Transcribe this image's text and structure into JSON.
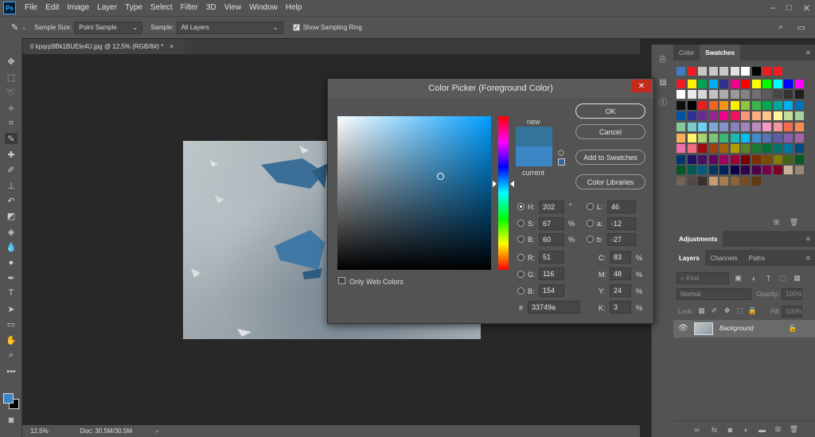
{
  "app": {
    "logo": "Ps"
  },
  "menu": [
    "File",
    "Edit",
    "Image",
    "Layer",
    "Type",
    "Select",
    "Filter",
    "3D",
    "View",
    "Window",
    "Help"
  ],
  "window_controls": {
    "minimize": "–",
    "restore": "□",
    "close": "✕"
  },
  "options": {
    "sample_size_label": "Sample Size:",
    "sample_size_value": "Point Sample",
    "sample_label": "Sample:",
    "sample_value": "All Layers",
    "show_ring_label": "Show Sampling Ring",
    "show_ring_checked": true
  },
  "document": {
    "tab_title": "0 kpqrp9Bk1BUEle4U.jpg @ 12.5% (RGB/8#) *",
    "close": "×"
  },
  "status": {
    "zoom": "12.5%",
    "doc_info": "Doc: 30.5M/30.5M",
    "arrow": "›"
  },
  "swatches_panel": {
    "tabs": [
      "Color",
      "Swatches"
    ],
    "active": "Swatches",
    "colors": [
      [
        "#3d7cc2",
        "#ee1d24",
        "#c8c8c8",
        "#c8c8c8",
        "#c8c8c8",
        "#e0e0e0",
        "#ffffff",
        "#000000",
        "#ee1d24",
        "#ee1d24"
      ],
      [
        "#ee1d24",
        "#fff200",
        "#00a651",
        "#00aeef",
        "#2e3192",
        "#ec008c",
        "#ff0000",
        "#ffff00",
        "#00ff00",
        "#00ffff",
        "#0000ff",
        "#ff00ff"
      ],
      [
        "#ffffff",
        "#ebebeb",
        "#d7d7d7",
        "#c2c2c2",
        "#adadad",
        "#999999",
        "#858585",
        "#707070",
        "#5c5c5c",
        "#474747",
        "#333333",
        "#1f1f1f"
      ],
      [
        "#0f0f0f",
        "#000000",
        "#ed1c24",
        "#f26522",
        "#f7941d",
        "#fff200",
        "#8dc63f",
        "#39b54a",
        "#00a651",
        "#00a99d",
        "#00aeef",
        "#0072bc"
      ],
      [
        "#0054a6",
        "#2e3192",
        "#662d91",
        "#92278f",
        "#ec008c",
        "#ed145b",
        "#f7977a",
        "#f9ad81",
        "#fdc68a",
        "#fff79a",
        "#c4df9b",
        "#a3d39c"
      ],
      [
        "#82ca9c",
        "#7accc8",
        "#6dcff6",
        "#7da7d9",
        "#8393ca",
        "#8781bd",
        "#a186be",
        "#bd8cbf",
        "#f49ac1",
        "#f5989d",
        "#f26c4f",
        "#f68e55"
      ],
      [
        "#fbaf5c",
        "#fff467",
        "#acd372",
        "#7cc576",
        "#3bb878",
        "#1abbb4",
        "#00bff3",
        "#438ccb",
        "#5574b9",
        "#605ca8",
        "#855fa8",
        "#a763a8"
      ],
      [
        "#f06ea9",
        "#f26d7d",
        "#9e0b0f",
        "#a0410d",
        "#a36209",
        "#aba000",
        "#598527",
        "#1a7b30",
        "#007236",
        "#00746b",
        "#0076a3",
        "#004b80"
      ],
      [
        "#003471",
        "#1b1464",
        "#440e62",
        "#630460",
        "#9e005d",
        "#9e0039",
        "#790000",
        "#7b2e00",
        "#7d4900",
        "#827b00",
        "#406618",
        "#005e20"
      ],
      [
        "#005826",
        "#005952",
        "#005b7f",
        "#003663",
        "#002157",
        "#0d004c",
        "#32004b",
        "#4b0049",
        "#7b0046",
        "#7a0026",
        "#c7b299",
        "#998675"
      ],
      [
        "#736357",
        "#534741",
        "#37302d",
        "#c69c6d",
        "#a67c52",
        "#8c6239",
        "#754c24",
        "#603913"
      ]
    ]
  },
  "adjustments_panel": {
    "tab": "Adjustments"
  },
  "layers_panel": {
    "tabs": [
      "Layers",
      "Channels",
      "Paths"
    ],
    "active": "Layers",
    "kind_label": "Kind",
    "blend_mode": "Normal",
    "opacity_label": "Opacity:",
    "opacity_value": "100%",
    "lock_label": "Lock:",
    "fill_label": "Fill:",
    "fill_value": "100%",
    "layers": [
      {
        "name": "Background",
        "visible": true,
        "locked": true
      }
    ]
  },
  "color_picker": {
    "title": "Color Picker (Foreground Color)",
    "close": "✕",
    "new_label": "new",
    "current_label": "current",
    "new_color": "#33749a",
    "current_color": "#3a85c4",
    "hue_base": "#009dff",
    "buttons": {
      "ok": "OK",
      "cancel": "Cancel",
      "add_to_swatches": "Add to Swatches",
      "color_libraries": "Color Libraries"
    },
    "only_web_colors": "Only Web Colors",
    "fields": {
      "H": {
        "value": "202",
        "unit": "°"
      },
      "S": {
        "value": "67",
        "unit": "%"
      },
      "B": {
        "value": "60",
        "unit": "%"
      },
      "R": {
        "value": "51"
      },
      "G": {
        "value": "116"
      },
      "B2": {
        "label": "B:",
        "value": "154"
      },
      "L": {
        "value": "46"
      },
      "a": {
        "value": "-12"
      },
      "b": {
        "value": "-27"
      },
      "C": {
        "value": "83",
        "unit": "%"
      },
      "M": {
        "value": "48",
        "unit": "%"
      },
      "Y": {
        "value": "24",
        "unit": "%"
      },
      "K": {
        "value": "3",
        "unit": "%"
      }
    },
    "hex_label": "#",
    "hex_value": "33749a",
    "selected_radio": "H"
  }
}
